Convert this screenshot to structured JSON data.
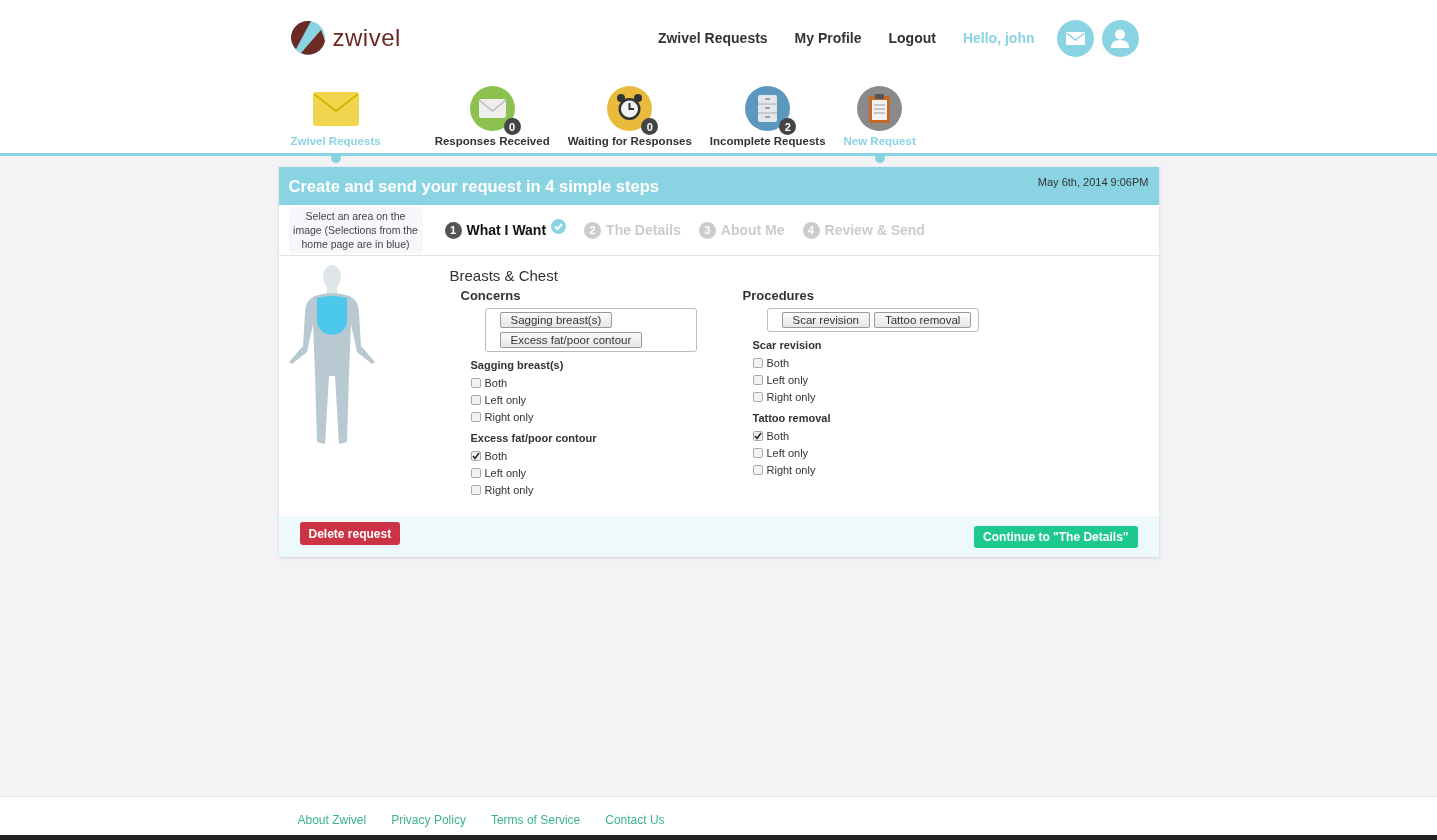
{
  "header": {
    "logo": "zwivel",
    "nav": [
      {
        "label": "Zwivel Requests",
        "kind": "link"
      },
      {
        "label": "My Profile",
        "kind": "link"
      },
      {
        "label": "Logout",
        "kind": "link"
      },
      {
        "label": "Hello, john",
        "kind": "greeting"
      }
    ],
    "icon_buttons": [
      {
        "kind": "mail"
      },
      {
        "kind": "user"
      }
    ]
  },
  "categories": [
    {
      "label": "Zwivel Requests",
      "kind": "envelope",
      "selected": true
    },
    {
      "label": "Responses Received",
      "kind": "inbox",
      "badge": "0",
      "selected": false
    },
    {
      "label": "Waiting for Responses",
      "kind": "clock",
      "badge": "0",
      "selected": false
    },
    {
      "label": "Incomplete Requests",
      "kind": "cabinet",
      "badge": "2",
      "selected": false
    },
    {
      "label": "New Request",
      "kind": "clipboard",
      "selected": true
    }
  ],
  "card": {
    "title": "Create and send your request in 4 simple steps",
    "date": "May 6th, 2014 9:06PM",
    "hint": "Select an area on the image (Selections from the home page are in blue)",
    "steps": [
      {
        "number": "1",
        "label": "What I Want",
        "selected": true,
        "done": true
      },
      {
        "number": "2",
        "label": "The Details",
        "selected": false,
        "done": false
      },
      {
        "number": "3",
        "label": "About Me",
        "selected": false,
        "done": false
      },
      {
        "number": "4",
        "label": "Review & Send",
        "selected": false,
        "done": false
      }
    ],
    "area": "Breasts & Chest",
    "columns": [
      {
        "heading": "Concerns",
        "tags": [
          "Sagging breast(s)",
          "Excess fat/poor contour"
        ],
        "groups": [
          {
            "title": "Sagging breast(s)",
            "options": [
              {
                "label": "Both",
                "checked": false
              },
              {
                "label": "Left only",
                "checked": false
              },
              {
                "label": "Right only",
                "checked": false
              }
            ]
          },
          {
            "title": "Excess fat/poor contour",
            "options": [
              {
                "label": "Both",
                "checked": true
              },
              {
                "label": "Left only",
                "checked": false
              },
              {
                "label": "Right only",
                "checked": false
              }
            ]
          }
        ]
      },
      {
        "heading": "Procedures",
        "tags": [
          "Scar revision",
          "Tattoo removal"
        ],
        "groups": [
          {
            "title": "Scar revision",
            "options": [
              {
                "label": "Both",
                "checked": false
              },
              {
                "label": "Left only",
                "checked": false
              },
              {
                "label": "Right only",
                "checked": false
              }
            ]
          },
          {
            "title": "Tattoo removal",
            "options": [
              {
                "label": "Both",
                "checked": true
              },
              {
                "label": "Left only",
                "checked": false
              },
              {
                "label": "Right only",
                "checked": false
              }
            ]
          }
        ]
      }
    ],
    "delete_button": "Delete request",
    "continue_button": "Continue to \"The Details\""
  },
  "footer": {
    "links": [
      "About Zwivel",
      "Privacy Policy",
      "Terms of Service",
      "Contact Us"
    ]
  }
}
